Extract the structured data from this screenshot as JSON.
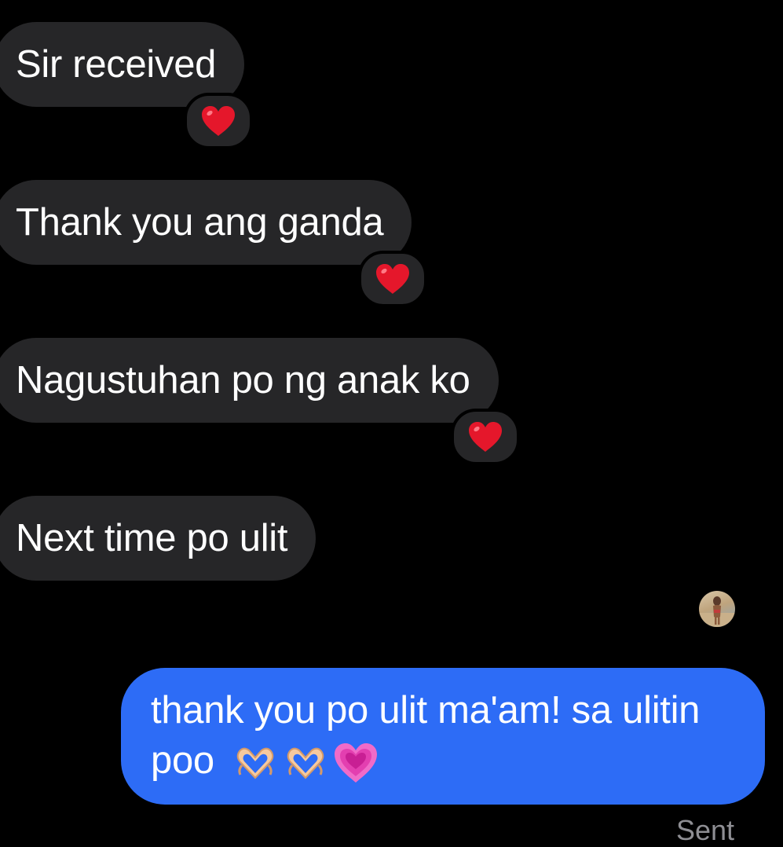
{
  "colors": {
    "background": "#000000",
    "incoming_bubble": "#262628",
    "outgoing_bubble": "#2d6cf6",
    "status_text": "#8e8e93"
  },
  "messages": [
    {
      "direction": "incoming",
      "text": "Sir received",
      "reaction": "red-heart"
    },
    {
      "direction": "incoming",
      "text": "Thank you ang ganda",
      "reaction": "red-heart"
    },
    {
      "direction": "incoming",
      "text": "Nagustuhan po ng anak ko",
      "reaction": "red-heart"
    },
    {
      "direction": "incoming",
      "text": "Next time po ulit"
    }
  ],
  "outgoing": {
    "line1": "thank you po ulit ma'am! sa ulitin",
    "line2": "poo",
    "emojis": [
      "heart-hands",
      "heart-hands",
      "growing-heart"
    ]
  },
  "read_receipt": {
    "icon": "avatar"
  },
  "status": "Sent"
}
